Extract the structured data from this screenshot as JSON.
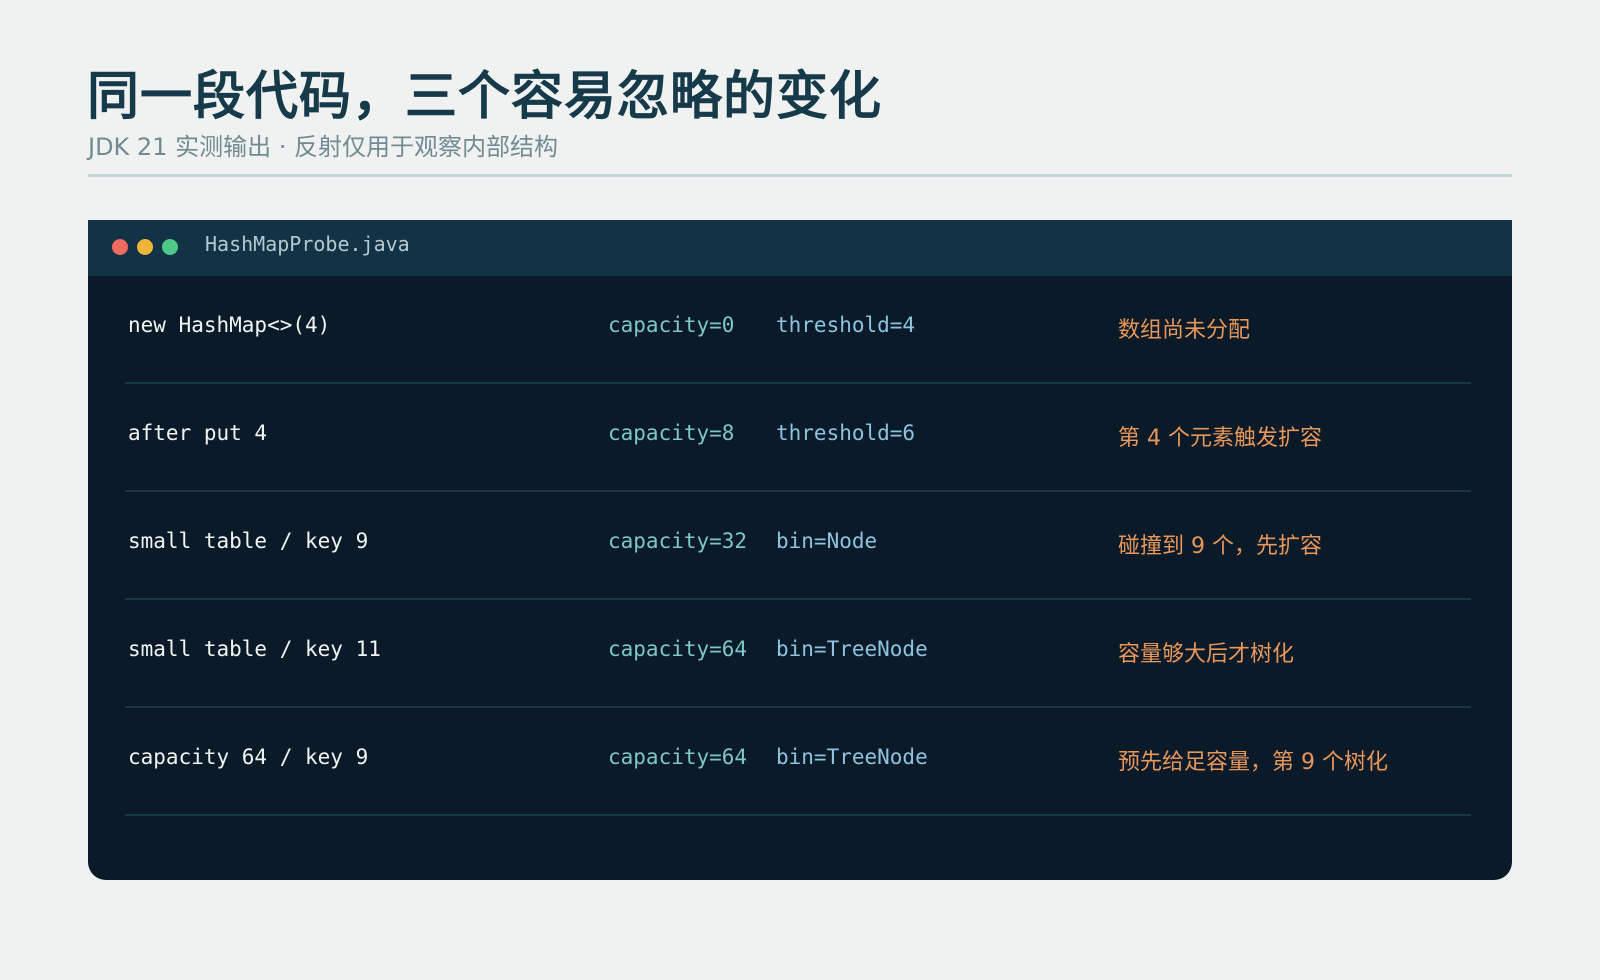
{
  "header": {
    "title": "同一段代码，三个容易忽略的变化",
    "subtitle": "JDK 21 实测输出 · 反射仅用于观察内部结构"
  },
  "window": {
    "filename": "HashMapProbe.java",
    "controls": {
      "close_color": "#ef6a5f",
      "minimize_color": "#efb43a",
      "maximize_color": "#4dc886"
    }
  },
  "rows": [
    {
      "code": "new HashMap<>(4)",
      "capacity": "capacity=0",
      "extra": "threshold=4",
      "note": "数组尚未分配"
    },
    {
      "code": "after put 4",
      "capacity": "capacity=8",
      "extra": "threshold=6",
      "note": "第 4 个元素触发扩容"
    },
    {
      "code": "small table / key 9",
      "capacity": "capacity=32",
      "extra": "bin=Node",
      "note": "碰撞到 9 个，先扩容"
    },
    {
      "code": "small table / key 11",
      "capacity": "capacity=64",
      "extra": "bin=TreeNode",
      "note": "容量够大后才树化"
    },
    {
      "code": "capacity 64 / key 9",
      "capacity": "capacity=64",
      "extra": "bin=TreeNode",
      "note": "预先给足容量，第 9 个树化"
    }
  ],
  "colors": {
    "background": "#eff2f0",
    "title": "#163a4a",
    "panel": "#0a1a28",
    "titlebar": "#123245",
    "code_text": "#f2f4f2",
    "capacity_text": "#7ec6c8",
    "extra_text": "#8dc3de",
    "note_text": "#e8975a"
  }
}
